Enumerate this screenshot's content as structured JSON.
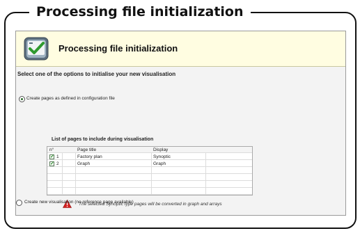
{
  "outer_title": "Processing file initialization",
  "banner": {
    "title": "Processing file initialization"
  },
  "instruction": "Select one of the options to initialise your new visualisation",
  "options": [
    {
      "label": "Create pages as defined in configuration file",
      "selected": true
    },
    {
      "label": "Create new visualisation (no reference page available)",
      "selected": false
    }
  ],
  "pages_list": {
    "title": "List of pages to include during visualisation",
    "columns": [
      "n°",
      "Page title",
      "Display"
    ],
    "rows": [
      {
        "checked": true,
        "number": "1",
        "title": "Factory plan",
        "display": "Synoptic"
      },
      {
        "checked": true,
        "number": "2",
        "title": "Graph",
        "display": "Graph"
      }
    ]
  },
  "warning": "The selected Synoptic type pages will be converted in graph and arrays",
  "colors": {
    "banner_bg": "#fffde1",
    "dialog_bg": "#f3f3f3",
    "warning_red": "#d42020"
  },
  "icons": {
    "banner": "checklist-icon",
    "warning": "warning-triangle-icon"
  }
}
